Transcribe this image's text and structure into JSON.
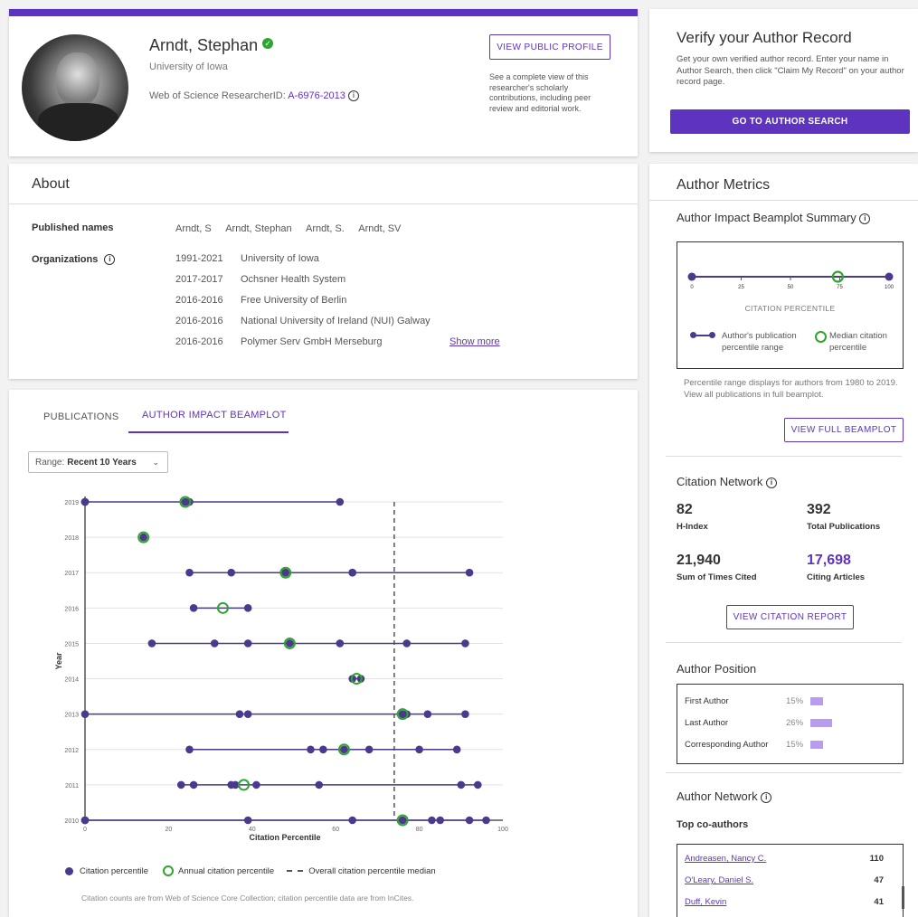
{
  "profile": {
    "name": "Arndt, Stephan",
    "affiliation": "University of Iowa",
    "researcher_id_label": "Web of Science ResearcherID:",
    "researcher_id": "A-6976-2013",
    "view_public_profile": "VIEW PUBLIC PROFILE",
    "public_profile_desc": "See a complete view of this researcher's scholarly contributions, including peer review and editorial work."
  },
  "verify": {
    "title": "Verify your Author Record",
    "desc": "Get your own verified author record. Enter your name in Author Search, then click \"Claim My Record\" on your author record page.",
    "button": "GO TO AUTHOR SEARCH"
  },
  "about": {
    "title": "About",
    "published_names_label": "Published names",
    "published_names": [
      "Arndt, S",
      "Arndt, Stephan",
      "Arndt, S.",
      "Arndt, SV"
    ],
    "organizations_label": "Organizations",
    "organizations": [
      {
        "years": "1991-2021",
        "name": "University of Iowa"
      },
      {
        "years": "2017-2017",
        "name": "Ochsner Health System"
      },
      {
        "years": "2016-2016",
        "name": "Free University of Berlin"
      },
      {
        "years": "2016-2016",
        "name": "National University of Ireland (NUI) Galway"
      },
      {
        "years": "2016-2016",
        "name": "Polymer Serv GmbH Merseburg"
      }
    ],
    "show_more": "Show more"
  },
  "tabs": {
    "publications": "PUBLICATIONS",
    "beamplot": "AUTHOR IMPACT BEAMPLOT"
  },
  "range": {
    "label": "Range:",
    "value": "Recent 10 Years"
  },
  "chart_data": {
    "type": "scatter",
    "xlabel": "Citation Percentile",
    "ylabel": "Year",
    "xlim": [
      0,
      100
    ],
    "x_ticks": [
      "0",
      "20",
      "40",
      "60",
      "80",
      "100"
    ],
    "median_line": 74,
    "rows": [
      {
        "year": "2019",
        "points": [
          0,
          0,
          0,
          0,
          24,
          24,
          25,
          61
        ],
        "annual": 24
      },
      {
        "year": "2018",
        "points": [
          14
        ],
        "annual": 14
      },
      {
        "year": "2017",
        "points": [
          25,
          35,
          48,
          48,
          64,
          64,
          92
        ],
        "annual": 48
      },
      {
        "year": "2016",
        "points": [
          26,
          39
        ],
        "annual": 33
      },
      {
        "year": "2015",
        "points": [
          16,
          31,
          39,
          49,
          61,
          77,
          91
        ],
        "annual": 49
      },
      {
        "year": "2014",
        "points": [
          64,
          66
        ],
        "annual": 65
      },
      {
        "year": "2013",
        "points": [
          0,
          37,
          39,
          76,
          76,
          77,
          82,
          91
        ],
        "annual": 76
      },
      {
        "year": "2012",
        "points": [
          25,
          54,
          57,
          62,
          68,
          80,
          89
        ],
        "annual": 62
      },
      {
        "year": "2011",
        "points": [
          23,
          26,
          35,
          36,
          41,
          56,
          90,
          94
        ],
        "annual": 38
      },
      {
        "year": "2010",
        "points": [
          0,
          0,
          0,
          39,
          64,
          76,
          76,
          83,
          85,
          92,
          96
        ],
        "annual": 76
      }
    ],
    "legend": [
      "Citation percentile",
      "Annual citation percentile",
      "Overall citation percentile median"
    ]
  },
  "chart_footnote": "Citation counts are from Web of Science Core Collection; citation percentile data are from InCites.",
  "metrics": {
    "title": "Author Metrics",
    "beamplot_summary_title": "Author Impact Beamplot Summary",
    "summary_ticks": [
      "0",
      "25",
      "50",
      "75",
      "100"
    ],
    "summary_range": [
      0,
      100
    ],
    "summary_median": 74,
    "summary_xlabel": "CITATION PERCENTILE",
    "legend_range": "Author's publication percentile range",
    "legend_median": "Median citation percentile",
    "summary_note": "Percentile range displays for authors from 1980 to 2019. View all publications in full beamplot.",
    "view_full_beamplot": "VIEW FULL BEAMPLOT"
  },
  "citation_network": {
    "title": "Citation Network",
    "h_index": "82",
    "h_index_label": "H-Index",
    "total_pubs": "392",
    "total_pubs_label": "Total Publications",
    "times_cited": "21,940",
    "times_cited_label": "Sum of Times Cited",
    "citing_articles": "17,698",
    "citing_articles_label": "Citing Articles",
    "button": "VIEW CITATION REPORT"
  },
  "author_position": {
    "title": "Author Position",
    "rows": [
      {
        "label": "First Author",
        "pct": "15%",
        "value": 15
      },
      {
        "label": "Last Author",
        "pct": "26%",
        "value": 26
      },
      {
        "label": "Corresponding Author",
        "pct": "15%",
        "value": 15
      }
    ]
  },
  "author_network": {
    "title": "Author Network",
    "top_coauthors_label": "Top co-authors",
    "coauthors": [
      {
        "name": "Andreasen, Nancy C.",
        "count": "110"
      },
      {
        "name": "O'Leary, Daniel S.",
        "count": "47"
      },
      {
        "name": "Duff, Kevin",
        "count": "41"
      }
    ]
  },
  "colors": {
    "accent": "#5e33bf",
    "dot": "#4b3a8c",
    "green": "#2ea52e",
    "bar": "#b79cf0"
  }
}
